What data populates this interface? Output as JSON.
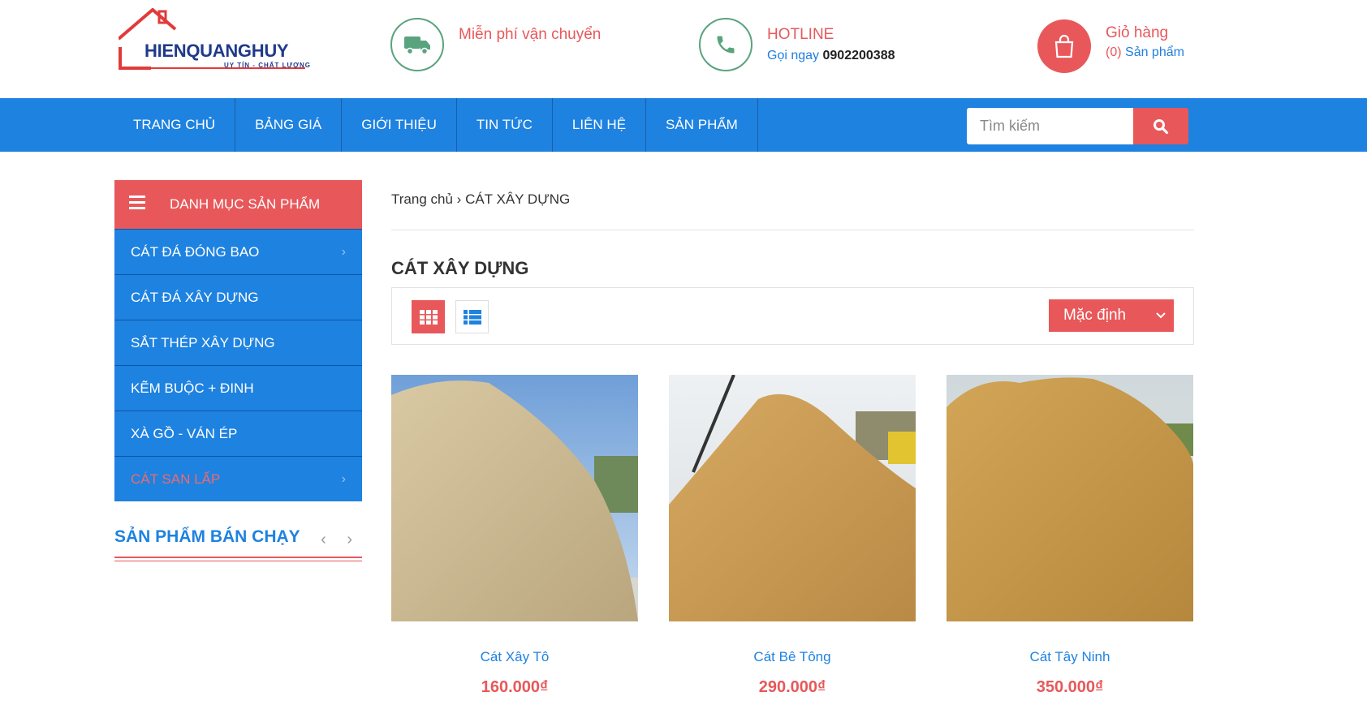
{
  "header": {
    "logo_text": "HIENQUANGHUY",
    "logo_tagline": "UY TÍN - CHẤT LƯỢNG",
    "shipping_text": "Miễn phí vận chuyển",
    "hotline_label": "HOTLINE",
    "call_label": "Gọi ngay",
    "phone": "0902200388",
    "cart_label": "Giỏ hàng",
    "cart_count": "(0)",
    "cart_unit": "Sản phẩm",
    "icons": [
      "truck-icon",
      "phone-icon",
      "shopping-bag-icon"
    ]
  },
  "nav": {
    "items": [
      "TRANG CHỦ",
      "BẢNG GIÁ",
      "GIỚI THIỆU",
      "TIN TỨC",
      "LIÊN HỆ",
      "SẢN PHẨM"
    ],
    "search_placeholder": "Tìm kiếm"
  },
  "sidebar": {
    "title": "DANH MỤC SẢN PHẨM",
    "items": [
      {
        "label": "CÁT ĐÁ ĐÓNG BAO",
        "chevron": "›"
      },
      {
        "label": "CÁT ĐÁ XÂY DỰNG",
        "chevron": ""
      },
      {
        "label": "SẮT THÉP XÂY DỰNG",
        "chevron": ""
      },
      {
        "label": "KẼM BUỘC + ĐINH",
        "chevron": ""
      },
      {
        "label": "XÀ GỒ - VÁN ÉP",
        "chevron": ""
      },
      {
        "label": "CÁT SAN LẤP",
        "chevron": "›"
      }
    ],
    "bestseller_title": "SẢN PHẨM BÁN CHẠY",
    "bestseller_arrows": "‹ ›"
  },
  "main": {
    "breadcrumb_home": "Trang chủ",
    "breadcrumb_sep": "›",
    "breadcrumb_current": "CÁT XÂY DỰNG",
    "title": "CÁT XÂY DỰNG",
    "sort_value": "Mặc định",
    "products": [
      {
        "name": "Cát Xây Tô",
        "price": "160.000₫"
      },
      {
        "name": "Cát Bê Tông",
        "price": "290.000₫"
      },
      {
        "name": "Cát Tây Ninh",
        "price": "350.000₫"
      }
    ]
  },
  "colors": {
    "accent_red": "#e8585a",
    "nav_blue": "#1e82e0",
    "icon_green": "#5aa37f"
  }
}
